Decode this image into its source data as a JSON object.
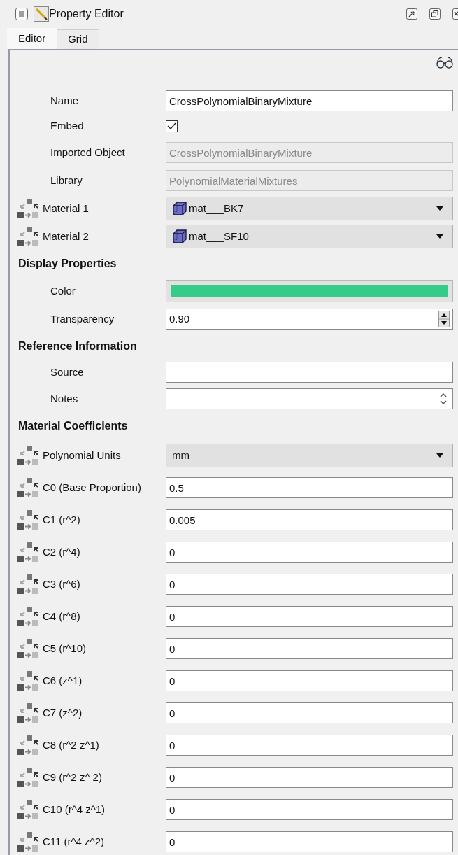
{
  "window": {
    "title": "Property Editor"
  },
  "tabs": [
    {
      "label": "Editor",
      "selected": true
    },
    {
      "label": "Grid",
      "selected": false
    }
  ],
  "rows": [
    {
      "kind": "text",
      "label": "Name",
      "value": "CrossPolynomialBinaryMixture",
      "linked": false
    },
    {
      "kind": "checkbox",
      "label": "Embed",
      "checked": true,
      "linked": false
    },
    {
      "kind": "readonly",
      "label": "Imported Object",
      "value": "CrossPolynomialBinaryMixture",
      "linked": false
    },
    {
      "kind": "readonly",
      "label": "Library",
      "value": "PolynomialMaterialMixtures",
      "linked": false
    },
    {
      "kind": "material",
      "label": "Material 1",
      "value": "mat___BK7",
      "linked": true
    },
    {
      "kind": "material",
      "label": "Material 2",
      "value": "mat___SF10",
      "linked": true
    },
    {
      "kind": "header",
      "label": "Display Properties"
    },
    {
      "kind": "color",
      "label": "Color",
      "color": "#34cc88",
      "linked": false
    },
    {
      "kind": "spin",
      "label": "Transparency",
      "value": "0.90",
      "linked": false
    },
    {
      "kind": "header",
      "label": "Reference Information"
    },
    {
      "kind": "text",
      "label": "Source",
      "value": "",
      "linked": false
    },
    {
      "kind": "notes",
      "label": "Notes",
      "value": "",
      "linked": false
    },
    {
      "kind": "header",
      "label": "Material Coefficients"
    },
    {
      "kind": "combo",
      "label": "Polynomial Units",
      "value": "mm",
      "linked": true
    },
    {
      "kind": "text",
      "label": "C0 (Base Proportion)",
      "value": "0.5",
      "linked": true
    },
    {
      "kind": "text",
      "label": "C1 (r^2)",
      "value": "0.005",
      "linked": true
    },
    {
      "kind": "text",
      "label": "C2 (r^4)",
      "value": "0",
      "linked": true
    },
    {
      "kind": "text",
      "label": "C3 (r^6)",
      "value": "0",
      "linked": true
    },
    {
      "kind": "text",
      "label": "C4 (r^8)",
      "value": "0",
      "linked": true
    },
    {
      "kind": "text",
      "label": "C5 (r^10)",
      "value": "0",
      "linked": true
    },
    {
      "kind": "text",
      "label": "C6 (z^1)",
      "value": "0",
      "linked": true
    },
    {
      "kind": "text",
      "label": "C7 (z^2)",
      "value": "0",
      "linked": true
    },
    {
      "kind": "text",
      "label": "C8 (r^2 z^1)",
      "value": "0",
      "linked": true
    },
    {
      "kind": "text",
      "label": "C9 (r^2 z^ 2)",
      "value": "0",
      "linked": true
    },
    {
      "kind": "text",
      "label": "C10 (r^4 z^1)",
      "value": "0",
      "linked": true
    },
    {
      "kind": "text",
      "label": "C11 (r^4 z^2)",
      "value": "0",
      "linked": true
    }
  ]
}
